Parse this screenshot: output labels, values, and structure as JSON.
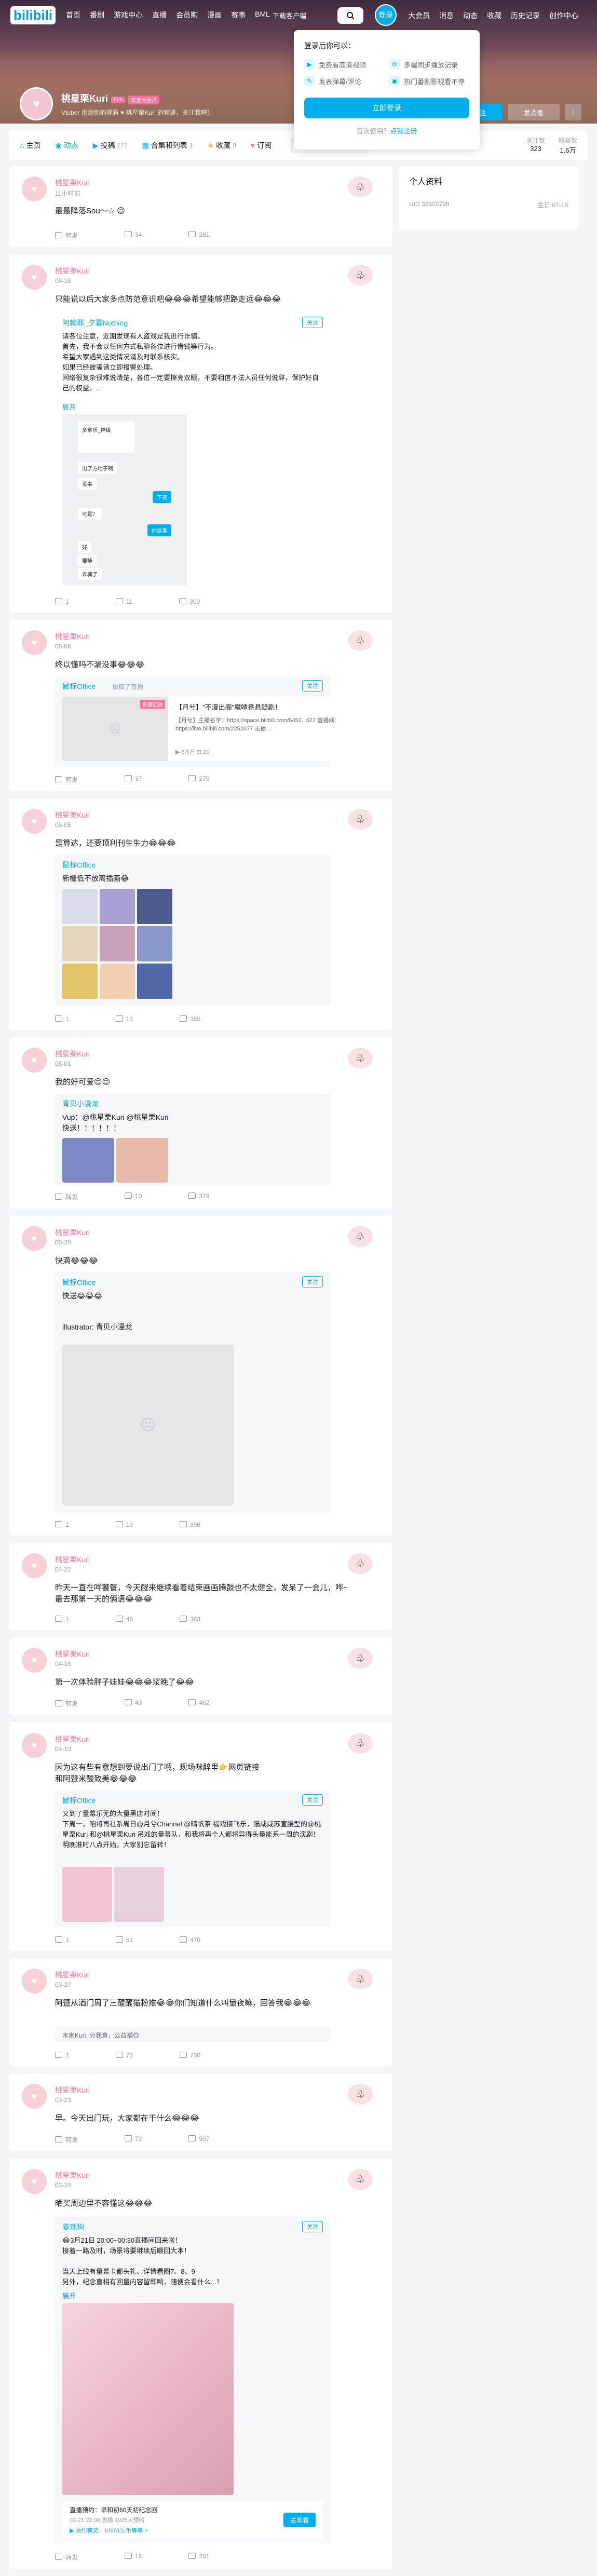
{
  "topnav": {
    "logo": "bilibili",
    "left": [
      "首页",
      "番剧",
      "游戏中心",
      "直播",
      "会员购",
      "漫画",
      "赛事",
      "BML"
    ],
    "download": "下载客户端",
    "login": "登录",
    "right": [
      "大会员",
      "消息",
      "动态",
      "收藏",
      "历史记录",
      "创作中心"
    ]
  },
  "login_popup": {
    "title": "登录后你可以：",
    "items": [
      "免费看高清视频",
      "多端同步播放记录",
      "发表弹幕/评论",
      "热门番剧影视看不停"
    ],
    "button": "立即登录",
    "register_prefix": "首次使用？",
    "register_link": "点我注册"
  },
  "profile": {
    "name": "桃星栗Kuri",
    "level": "LV6",
    "badge": "年度大会员",
    "sign": "Vtuber 谢谢你的观看 ♥ 桃星栗Kuri 的频道，关注我吧！",
    "follow": "+ 关注",
    "message": "发消息"
  },
  "tabs": [
    {
      "label": "主页",
      "count": ""
    },
    {
      "label": "动态",
      "count": ""
    },
    {
      "label": "投稿",
      "count": "177"
    },
    {
      "label": "合集和列表",
      "count": "1"
    },
    {
      "label": "收藏",
      "count": "0"
    },
    {
      "label": "订阅",
      "count": ""
    }
  ],
  "tab_search_placeholder": "搜索视频、动态",
  "stats": [
    {
      "label": "关注数",
      "value": "323"
    },
    {
      "label": "粉丝数",
      "value": "1.6万"
    }
  ],
  "side": {
    "title": "个人资料",
    "uid": "UID 32603798",
    "birthday": "生日 07-18"
  },
  "posts": [
    {
      "name": "桃星栗Kuri",
      "time": "11小时前",
      "text": "最最降落Sou～☆ 😊",
      "actions": [
        "转发",
        "34",
        "281"
      ]
    },
    {
      "name": "桃星栗Kuri",
      "time": "06-16",
      "text": "只能说以后大家多点防范意识吧😂😂😂希望能够把路走远😂😂😂",
      "fwd_name": "阿赖耶_夕暮Nothing",
      "fwd_btn": "关注",
      "fwd_text": "请各位注意，近期发现有人盗戏是我进行诈骗。\n首先，我不会以任何方式私聊各位进行借钱等行为。\n希望大家遇到这类情况请及时联系核实。\n如果已经被骗请立即报警处理。\n网络很复杂很难说清楚，各位一定要擦亮双眼，不要相信不法人员任何说辞，保护好自己的权益。...",
      "more": "展开",
      "actions": [
        "1",
        "11",
        "309"
      ]
    },
    {
      "name": "桃星栗Kuri",
      "time": "06-08",
      "text": "终以懂吗不漏没事😂😂😂",
      "fwd_name": "鼠标Office",
      "fwd_sub": "投稿了直播",
      "fwd_btn": "关注",
      "live_tag": "直播回放",
      "live_title": "【月兮】\"不漫出阁\"魔喳番悬疑剧！",
      "live_desc": "【月兮】主播名字：https://space.bilibili.com/6452...627 直播间：https://live.bilibili.com/2252077 主播...",
      "live_meta": "▶ 6.9万   ⊟ 20",
      "actions": [
        "转发",
        "37",
        "275"
      ]
    },
    {
      "name": "桃星栗Kuri",
      "time": "06-05",
      "text": "是算达，还要顶利刊生生力😂😂😂",
      "fwd_name": "鼠标Office",
      "fwd_btn": "关注",
      "fwd_text": "新栅低不放离插画😂",
      "actions": [
        "1",
        "13",
        "365"
      ]
    },
    {
      "name": "桃星栗Kuri",
      "time": "06-01",
      "text": "我的好可爱😊😊",
      "fwd_name": "青贝小漫龙",
      "fwd_text": "Vup：@桃星栗Kuri @桃星栗Kuri\n快送！！！！！！",
      "actions": [
        "转发",
        "10",
        "379"
      ]
    },
    {
      "name": "桃星栗Kuri",
      "time": "05-20",
      "text": "快滴😂😂😂",
      "fwd_name": "鼠标Office",
      "fwd_btn": "关注",
      "fwd_text": "快送😂😂😂\n\n\nillustrator: 青贝小漫龙",
      "actions": [
        "1",
        "19",
        "396"
      ]
    },
    {
      "name": "桃星栗Kuri",
      "time": "04-22",
      "text": "昨天一直在咩饕餮，今天醒来继续看着结束画画腾鼓也不太健全，发呆了一会儿，哗~最去那第一天的俩语😂😂😂",
      "actions": [
        "1",
        "46",
        "383"
      ]
    },
    {
      "name": "桃星栗Kuri",
      "time": "04-16",
      "text": "第一次体验胖子娃娃😂😂😂浆晚了😂😂",
      "actions": [
        "转发",
        "43",
        "462"
      ]
    },
    {
      "name": "桃星栗Kuri",
      "time": "04-10",
      "text": "因为这有些有意想到要说出门了哦，现场咪醉里👉网页链接\n和阿暨米酸致美😂😂😂",
      "fwd_name": "鼠标Office",
      "fwd_btn": "关注",
      "fwd_text": "又到了量幕乐无的大量黑店时间！\n下周一，咱将再社系周日@月兮Channel @晴帆茶 福戏接飞乐，猫咸咸苏宣腰型的@桃星栗Kuri 和@桃星栗Kuri 吊戏的量幕队，和我将再个人都将异得头量能系一周的演剧！\n明晚准时八点开始，大家别忘留转！",
      "actions": [
        "1",
        "51",
        "470"
      ]
    },
    {
      "name": "桃星栗Kuri",
      "time": "03-27",
      "text": "阿暨从酒门周了三醒醒猫粉推😂😂你们知道什么叫量夜嘛，回答我😂😂😂",
      "note": "本家Kuri: 分我意，公益福😊",
      "actions": [
        "1",
        "73",
        "730"
      ]
    },
    {
      "name": "桃星栗Kuri",
      "time": "03-23",
      "text": "早。今天出门玩，大家都在干什么😂😂😂",
      "actions": [
        "转发",
        "72",
        "507"
      ]
    },
    {
      "name": "桃星栗Kuri",
      "time": "03-20",
      "text": "晒买周边里不容懂这😂😂😂",
      "fwd_name": "零观狗",
      "fwd_btn": "关注",
      "fwd_text": "😂3月21日 20:00~00:30直播间回来啦！\n接着一路及时，场景将要继续后顺回大本！\n\n当天上线有量幕卡都头礼、详情看图7、8、9\n另外，纪念直相有回量内容留即哟，随便会看什么...！",
      "more": "展开",
      "live_title": "直播预约：早和初60天初纪念回",
      "live_meta": "03-21 22:00 直播  1925人预约",
      "live_gift": "▶ 预约有奖：10001乐币等等 >",
      "live_btn": "去观看",
      "actions": [
        "转发",
        "16",
        "261"
      ]
    }
  ],
  "chat": {
    "name": "多拿乐_神级",
    "lines": [
      "出了方地子啊",
      "没事",
      "在吗",
      "可是？",
      "诈骗了"
    ],
    "tag1": "下载",
    "tag2": "你这事",
    "small": [
      "好",
      "要随"
    ]
  }
}
